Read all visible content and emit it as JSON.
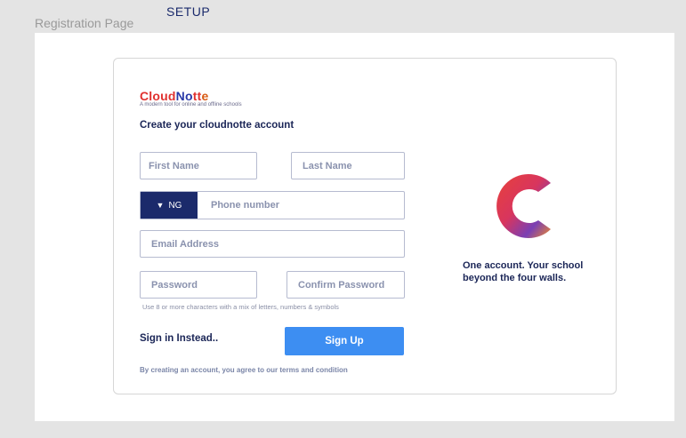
{
  "frame": {
    "label": "Registration Page",
    "setup_label": "SETUP"
  },
  "brand": {
    "logo_parts": [
      "Cloud",
      "No",
      "tt",
      "e"
    ],
    "tagline": "A modern tool for online and offline schools",
    "colors": {
      "navy": "#1b2a6b",
      "accent_blue": "#3d8ef2",
      "logo_red": "#e0312f"
    }
  },
  "form": {
    "heading": "Create your cloudnotte account",
    "first_name_placeholder": "First Name",
    "last_name_placeholder": "Last Name",
    "country_code": "NG",
    "country_icon": "triangle-down-icon",
    "phone_placeholder": "Phone number",
    "email_placeholder": "Email Address",
    "password_placeholder": "Password",
    "confirm_password_placeholder": "Confirm Password",
    "password_hint": "Use 8 or more characters with a mix of letters, numbers & symbols",
    "signin_link": "Sign in Instead..",
    "signup_button": "Sign Up",
    "terms": "By creating an account, you agree to our terms and condition"
  },
  "promo": {
    "text": "One account. Your school beyond the four walls."
  }
}
